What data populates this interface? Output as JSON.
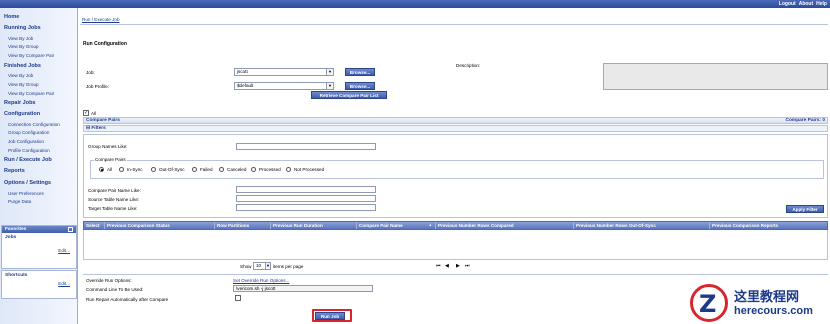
{
  "header": {
    "logout": "Logout",
    "about": "About",
    "help": "Help"
  },
  "sidebar": {
    "sections": [
      {
        "title": "Home"
      },
      {
        "title": "Running Jobs",
        "items": [
          "View By Job",
          "View By Group",
          "View By Compare Pair"
        ]
      },
      {
        "title": "Finished Jobs",
        "items": [
          "View By Job",
          "View By Group",
          "View By Compare Pair"
        ]
      },
      {
        "title": "Repair Jobs"
      },
      {
        "title": "Configuration",
        "items": [
          "Connection Configuration",
          "Group Configuration",
          "Job Configuration",
          "Profile Configuration"
        ]
      },
      {
        "title": "Run / Execute Job"
      },
      {
        "title": "Reports"
      },
      {
        "title": "Options / Settings",
        "items": [
          "User Preferences",
          "Purge Data"
        ]
      }
    ],
    "favorites": {
      "title": "Favorites",
      "jobs_label": "Jobs",
      "jobs_edit": "Edit...",
      "shortcuts_label": "Shortcuts",
      "shortcuts_edit": "Edit..."
    }
  },
  "breadcrumb": "Run / Execute Job",
  "run_config": {
    "title": "Run Configuration",
    "job_label": "Job:",
    "job_value": "jscott",
    "profile_label": "Job Profile:",
    "profile_value": "$default",
    "browse_label": "Browse...",
    "retrieve_label": "Retrieve Compare Pair List",
    "description_label": "Description:"
  },
  "compare_pairs": {
    "all_label": "All",
    "bar_label": "Compare Pairs",
    "count_label": "Compare Pairs: 0",
    "filters_label": "Filters",
    "group_names_label": "Group Names Like:",
    "group_box_label": "Compare Pairs",
    "radio_options": [
      "All",
      "In-Sync",
      "Out-Of-Sync",
      "Failed",
      "Canceled",
      "Processed",
      "Not Processed"
    ],
    "pair_name_label": "Compare Pair Name Like:",
    "source_label": "Source Table Name Like:",
    "target_label": "Target Table Name Like:",
    "apply_label": "Apply Filter"
  },
  "table": {
    "columns": [
      "Select",
      "Previous Comparison Status",
      "Row Partitions",
      "Previous Run Duration",
      "Compare Pair Name",
      "Previous Number Rows Compared",
      "Previous Number Rows Out-Of-Sync",
      "Previous Comparison Reports"
    ],
    "sort_icon": "▲"
  },
  "pager": {
    "show_label": "Show",
    "page_size": "10",
    "items_label": "items per page",
    "nav_icons": [
      "⏮",
      "◀",
      "▶",
      "⏭"
    ]
  },
  "run_options": {
    "override_label": "Override Run Options:",
    "override_link": "Set Override Run Options...",
    "command_label": "Command Line To Be Used:",
    "command_value": "\\vericom.sh -j jscott",
    "repair_label": "Run Repair Automatically after Compare",
    "run_button": "Run Job"
  },
  "watermark": {
    "logo_text": "Z",
    "cn_text": "这里教程网",
    "url_text": "herecours.com"
  },
  "colors": {
    "header": "#3454a6",
    "sidebar": "#e6edf9",
    "accent": "#d9262c",
    "link": "#1c3a8a"
  }
}
